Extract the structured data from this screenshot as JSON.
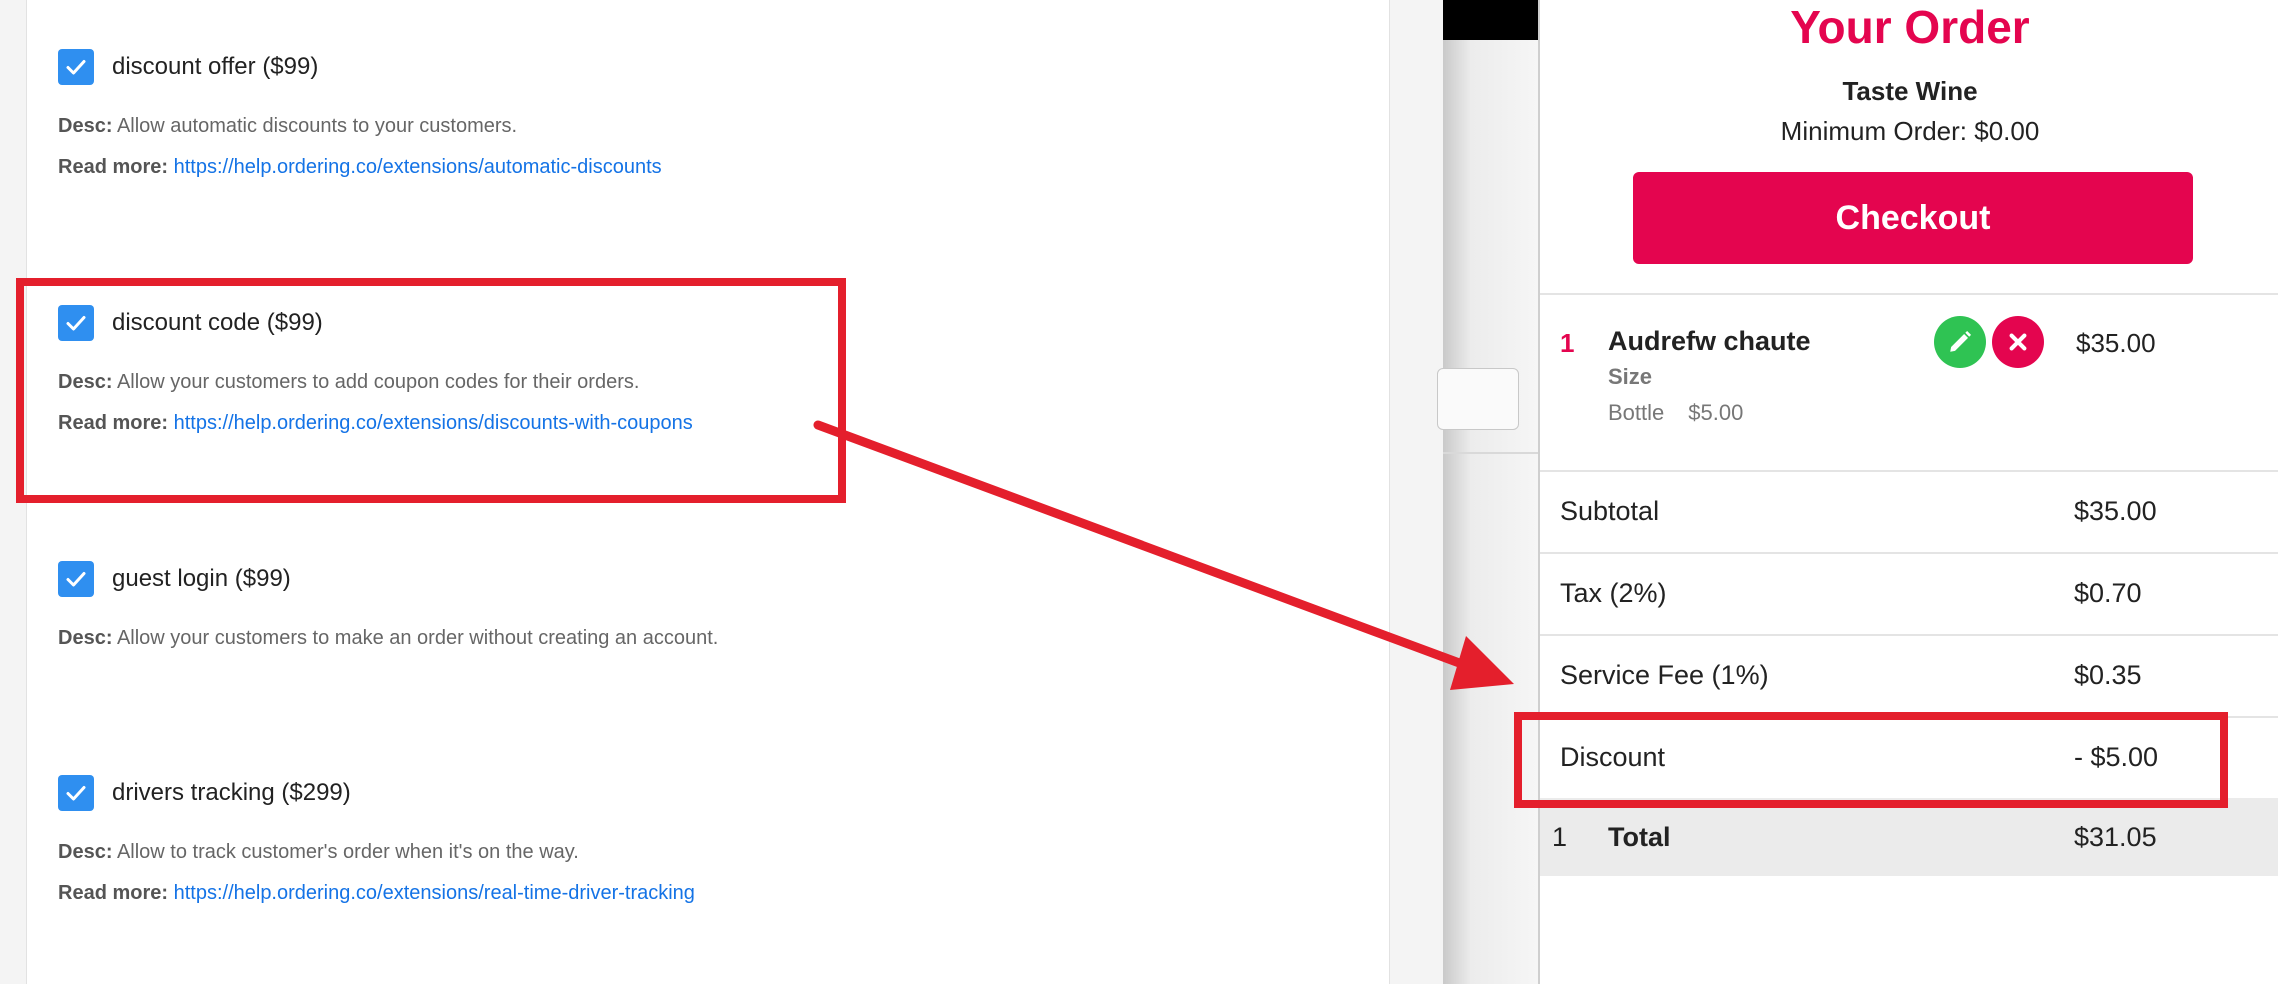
{
  "extensions": [
    {
      "title": "discount offer ($99)",
      "desc_label": "Desc:",
      "desc": "Allow automatic discounts to your customers.",
      "more_label": "Read more:",
      "link": "https://help.ordering.co/extensions/automatic-discounts"
    },
    {
      "title": "discount code ($99)",
      "desc_label": "Desc:",
      "desc": "Allow your customers to add coupon codes for their orders.",
      "more_label": "Read more:",
      "link": "https://help.ordering.co/extensions/discounts-with-coupons"
    },
    {
      "title": "guest login ($99)",
      "desc_label": "Desc:",
      "desc": "Allow your customers to make an order without creating an account."
    },
    {
      "title": "drivers tracking ($299)",
      "desc_label": "Desc:",
      "desc": "Allow to track customer's order when it's on the way.",
      "more_label": "Read more:",
      "link": "https://help.ordering.co/extensions/real-time-driver-tracking"
    }
  ],
  "order": {
    "title": "Your Order",
    "store": "Taste Wine",
    "minimum": "Minimum Order: $0.00",
    "checkout_label": "Checkout",
    "item": {
      "qty": "1",
      "name": "Audrefw chaute",
      "option_title": "Size",
      "option_value": "Bottle",
      "option_price": "$5.00",
      "price": "$35.00"
    },
    "summary": [
      {
        "label": "Subtotal",
        "value": "$35.00"
      },
      {
        "label": "Tax (2%)",
        "value": "$0.70"
      },
      {
        "label": "Service Fee (1%)",
        "value": "$0.35"
      },
      {
        "label": "Discount",
        "value": "- $5.00"
      }
    ],
    "total": {
      "count": "1",
      "label": "Total",
      "value": "$31.05"
    }
  },
  "colors": {
    "brand": "#e4054f",
    "checkbox": "#2f8ff0",
    "link": "#1473e6",
    "edit": "#2fc353",
    "annotation": "#e41f2c"
  },
  "icons": [
    "check-icon",
    "pencil-icon",
    "close-icon"
  ]
}
